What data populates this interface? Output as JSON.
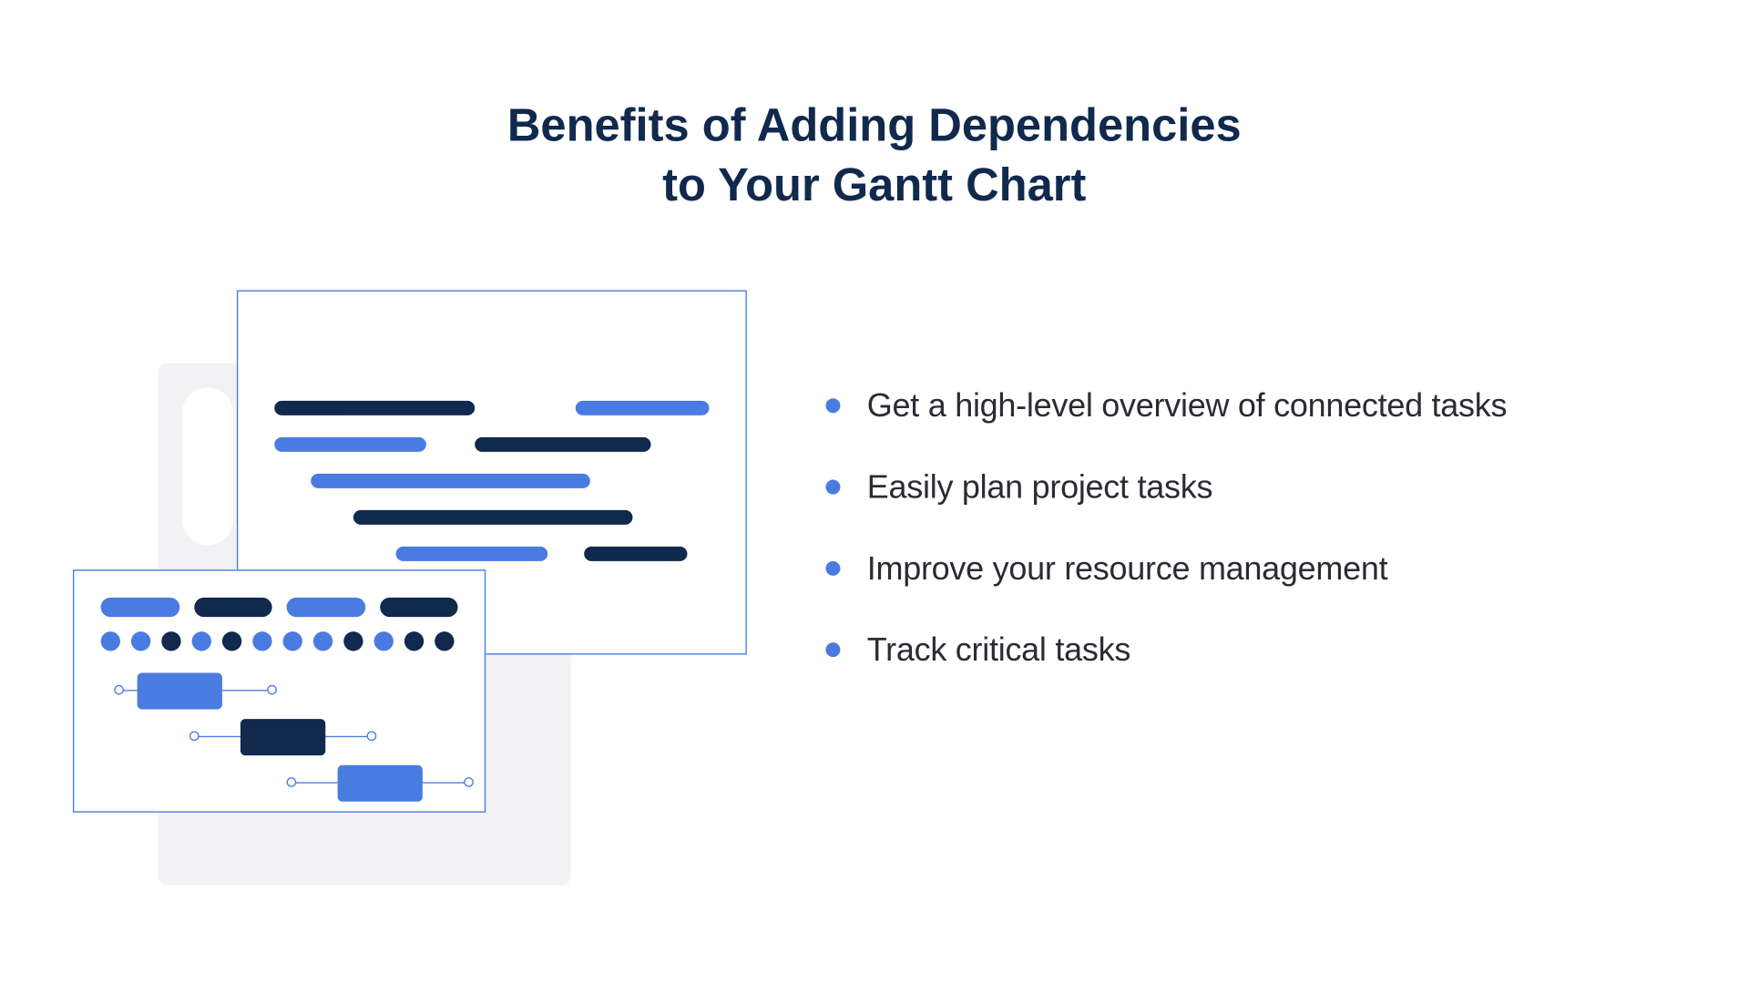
{
  "title_line1": "Benefits of Adding Dependencies",
  "title_line2": "to Your Gantt Chart",
  "bullets": [
    "Get a high-level overview of connected tasks",
    "Easily plan project tasks",
    "Improve your resource management",
    "Track critical tasks"
  ],
  "colors": {
    "dark_navy": "#10294d",
    "blue": "#4a7be0",
    "grey_bg": "#f2f2f5",
    "text": "#2b2b33"
  }
}
